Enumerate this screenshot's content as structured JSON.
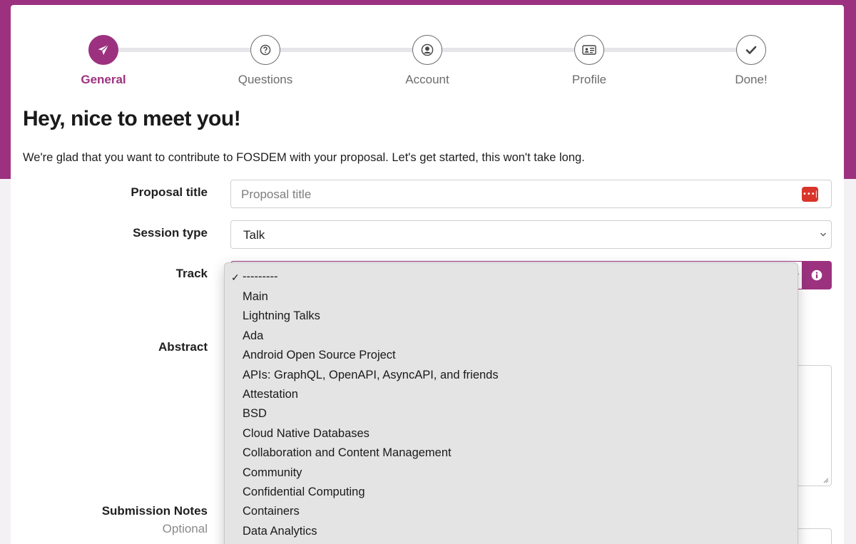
{
  "steps": [
    {
      "label": "General",
      "icon": "paper-plane-icon",
      "active": true
    },
    {
      "label": "Questions",
      "icon": "question-circle-icon",
      "active": false
    },
    {
      "label": "Account",
      "icon": "user-circle-icon",
      "active": false
    },
    {
      "label": "Profile",
      "icon": "id-card-icon",
      "active": false
    },
    {
      "label": "Done!",
      "icon": "checkmark-icon",
      "active": false
    }
  ],
  "heading": "Hey, nice to meet you!",
  "intro": "We're glad that you want to contribute to FOSDEM with your proposal. Let's get started, this won't take long.",
  "form": {
    "proposal_title_label": "Proposal title",
    "proposal_title_placeholder": "Proposal title",
    "session_type_label": "Session type",
    "session_type_value": "Talk",
    "track_label": "Track",
    "abstract_label": "Abstract",
    "submission_notes_label": "Submission Notes",
    "submission_notes_sub": "Optional"
  },
  "track_dropdown": {
    "selected": "---------",
    "options": [
      "---------",
      "Main",
      "Lightning Talks",
      "Ada",
      "Android Open Source Project",
      "APIs: GraphQL, OpenAPI, AsyncAPI, and friends",
      "Attestation",
      "BSD",
      "Cloud Native Databases",
      "Collaboration and Content Management",
      "Community",
      "Confidential Computing",
      "Containers",
      "Data Analytics"
    ]
  },
  "colors": {
    "brand": "#9c327f",
    "password_manager_icon": "#d9352b"
  }
}
